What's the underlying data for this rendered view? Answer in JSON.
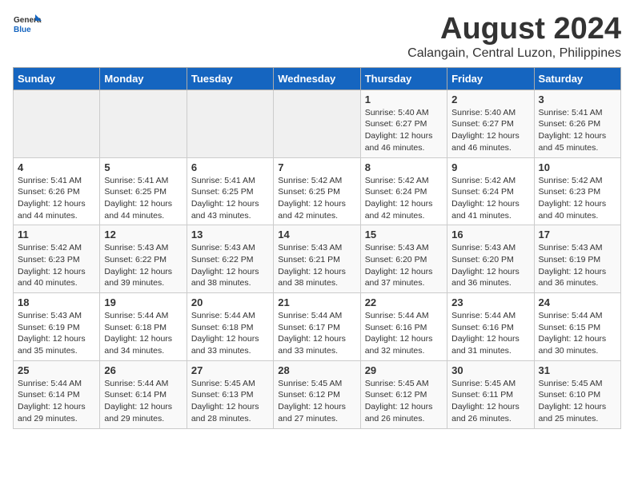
{
  "logo": {
    "general": "General",
    "blue": "Blue"
  },
  "title": "August 2024",
  "subtitle": "Calangain, Central Luzon, Philippines",
  "weekdays": [
    "Sunday",
    "Monday",
    "Tuesday",
    "Wednesday",
    "Thursday",
    "Friday",
    "Saturday"
  ],
  "weeks": [
    [
      {
        "day": "",
        "info": ""
      },
      {
        "day": "",
        "info": ""
      },
      {
        "day": "",
        "info": ""
      },
      {
        "day": "",
        "info": ""
      },
      {
        "day": "1",
        "info": "Sunrise: 5:40 AM\nSunset: 6:27 PM\nDaylight: 12 hours\nand 46 minutes."
      },
      {
        "day": "2",
        "info": "Sunrise: 5:40 AM\nSunset: 6:27 PM\nDaylight: 12 hours\nand 46 minutes."
      },
      {
        "day": "3",
        "info": "Sunrise: 5:41 AM\nSunset: 6:26 PM\nDaylight: 12 hours\nand 45 minutes."
      }
    ],
    [
      {
        "day": "4",
        "info": "Sunrise: 5:41 AM\nSunset: 6:26 PM\nDaylight: 12 hours\nand 44 minutes."
      },
      {
        "day": "5",
        "info": "Sunrise: 5:41 AM\nSunset: 6:25 PM\nDaylight: 12 hours\nand 44 minutes."
      },
      {
        "day": "6",
        "info": "Sunrise: 5:41 AM\nSunset: 6:25 PM\nDaylight: 12 hours\nand 43 minutes."
      },
      {
        "day": "7",
        "info": "Sunrise: 5:42 AM\nSunset: 6:25 PM\nDaylight: 12 hours\nand 42 minutes."
      },
      {
        "day": "8",
        "info": "Sunrise: 5:42 AM\nSunset: 6:24 PM\nDaylight: 12 hours\nand 42 minutes."
      },
      {
        "day": "9",
        "info": "Sunrise: 5:42 AM\nSunset: 6:24 PM\nDaylight: 12 hours\nand 41 minutes."
      },
      {
        "day": "10",
        "info": "Sunrise: 5:42 AM\nSunset: 6:23 PM\nDaylight: 12 hours\nand 40 minutes."
      }
    ],
    [
      {
        "day": "11",
        "info": "Sunrise: 5:42 AM\nSunset: 6:23 PM\nDaylight: 12 hours\nand 40 minutes."
      },
      {
        "day": "12",
        "info": "Sunrise: 5:43 AM\nSunset: 6:22 PM\nDaylight: 12 hours\nand 39 minutes."
      },
      {
        "day": "13",
        "info": "Sunrise: 5:43 AM\nSunset: 6:22 PM\nDaylight: 12 hours\nand 38 minutes."
      },
      {
        "day": "14",
        "info": "Sunrise: 5:43 AM\nSunset: 6:21 PM\nDaylight: 12 hours\nand 38 minutes."
      },
      {
        "day": "15",
        "info": "Sunrise: 5:43 AM\nSunset: 6:20 PM\nDaylight: 12 hours\nand 37 minutes."
      },
      {
        "day": "16",
        "info": "Sunrise: 5:43 AM\nSunset: 6:20 PM\nDaylight: 12 hours\nand 36 minutes."
      },
      {
        "day": "17",
        "info": "Sunrise: 5:43 AM\nSunset: 6:19 PM\nDaylight: 12 hours\nand 36 minutes."
      }
    ],
    [
      {
        "day": "18",
        "info": "Sunrise: 5:43 AM\nSunset: 6:19 PM\nDaylight: 12 hours\nand 35 minutes."
      },
      {
        "day": "19",
        "info": "Sunrise: 5:44 AM\nSunset: 6:18 PM\nDaylight: 12 hours\nand 34 minutes."
      },
      {
        "day": "20",
        "info": "Sunrise: 5:44 AM\nSunset: 6:18 PM\nDaylight: 12 hours\nand 33 minutes."
      },
      {
        "day": "21",
        "info": "Sunrise: 5:44 AM\nSunset: 6:17 PM\nDaylight: 12 hours\nand 33 minutes."
      },
      {
        "day": "22",
        "info": "Sunrise: 5:44 AM\nSunset: 6:16 PM\nDaylight: 12 hours\nand 32 minutes."
      },
      {
        "day": "23",
        "info": "Sunrise: 5:44 AM\nSunset: 6:16 PM\nDaylight: 12 hours\nand 31 minutes."
      },
      {
        "day": "24",
        "info": "Sunrise: 5:44 AM\nSunset: 6:15 PM\nDaylight: 12 hours\nand 30 minutes."
      }
    ],
    [
      {
        "day": "25",
        "info": "Sunrise: 5:44 AM\nSunset: 6:14 PM\nDaylight: 12 hours\nand 29 minutes."
      },
      {
        "day": "26",
        "info": "Sunrise: 5:44 AM\nSunset: 6:14 PM\nDaylight: 12 hours\nand 29 minutes."
      },
      {
        "day": "27",
        "info": "Sunrise: 5:45 AM\nSunset: 6:13 PM\nDaylight: 12 hours\nand 28 minutes."
      },
      {
        "day": "28",
        "info": "Sunrise: 5:45 AM\nSunset: 6:12 PM\nDaylight: 12 hours\nand 27 minutes."
      },
      {
        "day": "29",
        "info": "Sunrise: 5:45 AM\nSunset: 6:12 PM\nDaylight: 12 hours\nand 26 minutes."
      },
      {
        "day": "30",
        "info": "Sunrise: 5:45 AM\nSunset: 6:11 PM\nDaylight: 12 hours\nand 26 minutes."
      },
      {
        "day": "31",
        "info": "Sunrise: 5:45 AM\nSunset: 6:10 PM\nDaylight: 12 hours\nand 25 minutes."
      }
    ]
  ]
}
